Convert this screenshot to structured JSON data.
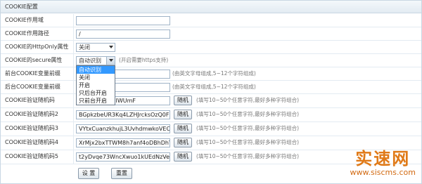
{
  "header": {
    "title": "COOKIE配置"
  },
  "rows": [
    {
      "label": "COOKIE作用域",
      "value": ""
    },
    {
      "label": "COOKIE作用路径",
      "value": "/"
    },
    {
      "label": "COOKIE的HttpOnly属性",
      "value": "关闭"
    },
    {
      "label": "COOKIE的secure属性",
      "value": "自动识别",
      "hint": "(开启需要https支持)"
    },
    {
      "label": "前台COOKIE变量前缀",
      "hint": "(由英文字母组成,5~12个字符组成)"
    },
    {
      "label": "后台COOKIE变量前缀",
      "hint": "(由英文字母组成,5~12个字符组成)"
    },
    {
      "label": "COOKIE验证随机码",
      "value": "OuXDFeC9kqIWUmF",
      "button": "随机",
      "hint": "(填写10~50个任意字符,最好多种字符组合)"
    },
    {
      "label": "COOKIE验证随机码2",
      "value": "BGpkzbeUR3Kq4LZHJrcksOzQ0F7Q6",
      "button": "随机",
      "hint": "(填写10~50个任意字符,最好多种字符组合)"
    },
    {
      "label": "COOKIE验证随机码3",
      "value": "VYtxCuanzkhujL3UvhdmwkoVEOJ0k",
      "button": "随机",
      "hint": "(填写10~50个任意字符,最好多种字符组合)"
    },
    {
      "label": "COOKIE验证随机码4",
      "value": "XrMjx2bxTTWM8h7anf4oDBhDhYS",
      "button": "随机",
      "hint": "(填写10~50个任意字符,最好多种字符组合)"
    },
    {
      "label": "COOKIE验证随机码5",
      "value": "t2yDvqe73WncXwuo1kUEdNzVeHS",
      "button": "随机",
      "hint": "(填写10~50个任意字符,最好多种字符组合)"
    }
  ],
  "dropdown": {
    "options": [
      "自动识别",
      "关闭",
      "开启",
      "只后台开启",
      "只前台开启"
    ],
    "selected": "自动识别"
  },
  "buttons": {
    "save": "设 置",
    "reset": "重置"
  },
  "watermark": {
    "cn": "实速网",
    "url": "www.siscms.com"
  }
}
